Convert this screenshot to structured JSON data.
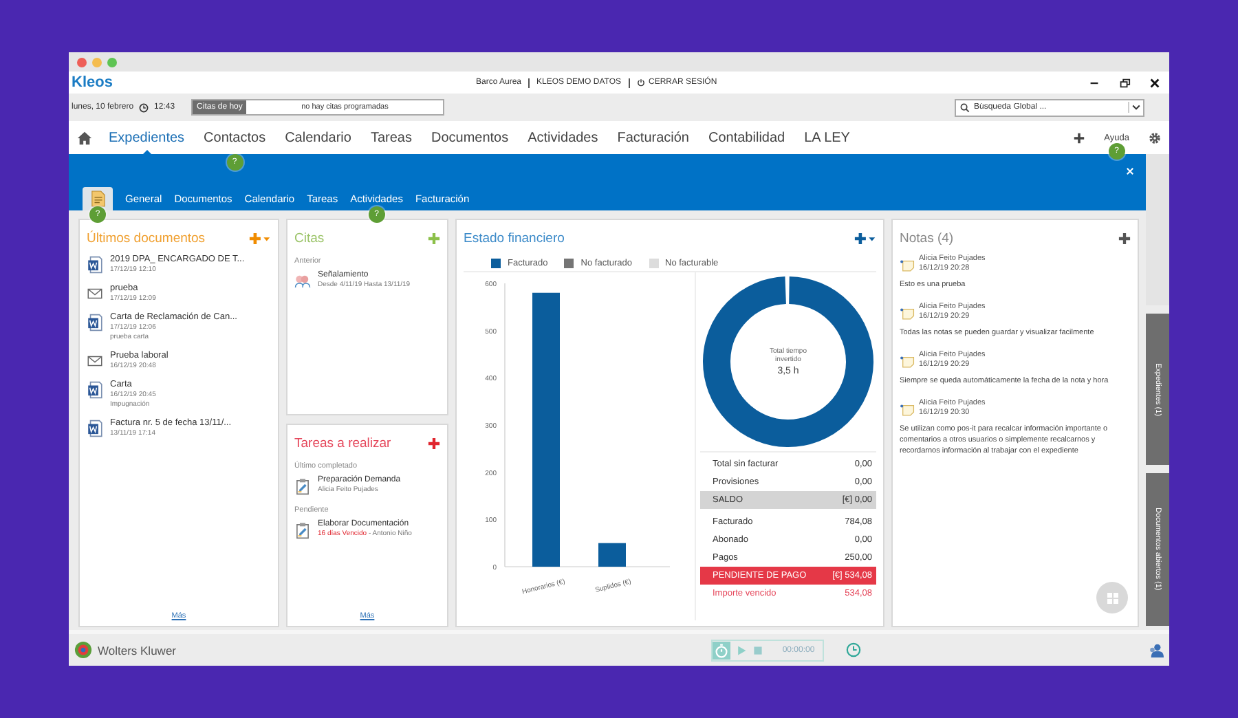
{
  "app": {
    "logo": "Kleos",
    "user": "Barco Aurea",
    "database": "KLEOS DEMO DATOS",
    "logout": "CERRAR SESIÓN"
  },
  "infobar": {
    "date": "lunes, 10 febrero",
    "time": "12:43",
    "appointments_label": "Citas de hoy",
    "appointments_value": "no hay citas programadas",
    "search": {
      "placeholder": "Búsqueda Global ..."
    }
  },
  "nav": {
    "items": [
      {
        "label": "Expedientes",
        "selected": true
      },
      {
        "label": "Contactos",
        "selected": false,
        "hint": "?"
      },
      {
        "label": "Calendario",
        "selected": false
      },
      {
        "label": "Tareas",
        "selected": false
      },
      {
        "label": "Documentos",
        "selected": false
      },
      {
        "label": "Actividades",
        "selected": false
      },
      {
        "label": "Facturación",
        "selected": false
      },
      {
        "label": "Contabilidad",
        "selected": false
      },
      {
        "label": "LA LEY",
        "selected": false
      }
    ],
    "help": "Ayuda",
    "help_hint": "?"
  },
  "record": {
    "icon_tab": {
      "selected": true,
      "hint": "?"
    },
    "tabs": [
      {
        "label": "General",
        "selected": false
      },
      {
        "label": "Documentos",
        "selected": false
      },
      {
        "label": "Calendario",
        "selected": false
      },
      {
        "label": "Tareas",
        "selected": false
      },
      {
        "label": "Actividades",
        "selected": false,
        "hint": "?"
      },
      {
        "label": "Facturación",
        "selected": false
      }
    ]
  },
  "documents": {
    "title": "Últimos documentos",
    "more": "Más",
    "items": [
      {
        "kind": "word",
        "name": "2019 DPA_ ENCARGADO DE T...",
        "date": "17/12/19 12:10"
      },
      {
        "kind": "mail",
        "name": "prueba",
        "date": "17/12/19 12:09"
      },
      {
        "kind": "word",
        "name": "Carta de Reclamación de Can...",
        "date": "17/12/19 12:06",
        "note": "prueba carta"
      },
      {
        "kind": "mail",
        "name": "Prueba laboral",
        "date": "16/12/19 20:48"
      },
      {
        "kind": "word",
        "name": "Carta",
        "date": "16/12/19 20:45",
        "note": "Impugnación"
      },
      {
        "kind": "word",
        "name": "Factura nr. 5 de fecha 13/11/...",
        "date": "13/11/19 17:14"
      }
    ]
  },
  "appointments": {
    "title": "Citas",
    "section": "Anterior",
    "items": [
      {
        "name": "Señalamiento",
        "range": "Desde 4/11/19 Hasta 13/11/19"
      }
    ]
  },
  "tasks": {
    "title": "Tareas a realizar",
    "more": "Más",
    "groups": [
      {
        "label": "Último completado",
        "items": [
          {
            "name": "Preparación Demanda",
            "person": "Alicia Feito Pujades"
          }
        ]
      },
      {
        "label": "Pendiente",
        "items": [
          {
            "name": "Elaborar Documentación",
            "overdue": "16 días Vencido",
            "person": "- Antonio Niño"
          }
        ]
      }
    ]
  },
  "finance": {
    "title": "Estado financiero",
    "chart_data": {
      "type": "bar",
      "categories": [
        "Honorarios (€)",
        "Suplidos (€)"
      ],
      "series": [
        {
          "name": "Facturado",
          "color": "#0b5d9c",
          "values": [
            580,
            50
          ]
        },
        {
          "name": "No facturado",
          "color": "#757575",
          "values": [
            null,
            null
          ]
        },
        {
          "name": "No facturable",
          "color": "#dcdcdc",
          "values": [
            null,
            null
          ]
        }
      ],
      "ylim": [
        0,
        600
      ],
      "yticks": [
        0,
        100,
        200,
        300,
        400,
        500,
        600
      ]
    },
    "time_label": "Total tiempo invertido",
    "time_value": "3,5 h",
    "rows": [
      {
        "kind": "plain",
        "label": "Total sin facturar",
        "value": "0,00"
      },
      {
        "kind": "plain",
        "label": "Provisiones",
        "value": "0,00"
      },
      {
        "kind": "total",
        "label": "SALDO",
        "value": "[€] 0,00"
      },
      {
        "kind": "plain",
        "label": "Facturado",
        "value": "784,08"
      },
      {
        "kind": "plain",
        "label": "Abonado",
        "value": "0,00"
      },
      {
        "kind": "plain",
        "label": "Pagos",
        "value": "250,00"
      },
      {
        "kind": "alert",
        "label": "PENDIENTE DE PAGO",
        "value": "[€] 534,08"
      },
      {
        "kind": "warning",
        "label": "Importe vencido",
        "value": "534,08"
      }
    ]
  },
  "notes": {
    "title": "Notas (4)",
    "items": [
      {
        "author": "Alicia Feito Pujades",
        "date": "16/12/19 20:28",
        "text": "Esto es una prueba"
      },
      {
        "author": "Alicia Feito Pujades",
        "date": "16/12/19 20:29",
        "text": "Todas las notas se pueden guardar y visualizar facilmente"
      },
      {
        "author": "Alicia Feito Pujades",
        "date": "16/12/19 20:29",
        "text": "Siempre se queda automáticamente la fecha de la nota y hora"
      },
      {
        "author": "Alicia Feito Pujades",
        "date": "16/12/19 20:30",
        "text": "Se utilizan como pos-it para recalcar información importante o comentarios a otros usuarios o simplemente recalcarnos y recordarnos información al trabajar con el expediente"
      }
    ]
  },
  "side_tabs": [
    {
      "selected": true
    },
    {
      "label": "Expedientes (1)",
      "selected": false
    },
    {
      "label": "Documentos abiertos (1)",
      "selected": false
    }
  ],
  "footer": {
    "brand": "Wolters Kluwer",
    "timer": "00:00:00"
  }
}
